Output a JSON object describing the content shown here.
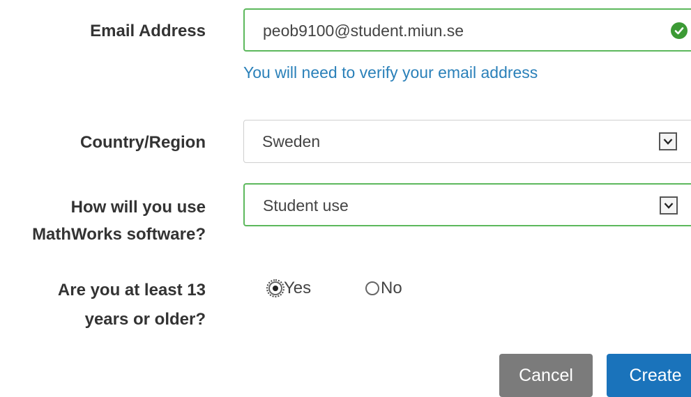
{
  "email": {
    "label": "Email Address",
    "value": "peob9100@student.miun.se",
    "status_icon": "check-circle-icon",
    "hint": "You will need to verify your email address"
  },
  "country": {
    "label": "Country/Region",
    "selected": "Sweden"
  },
  "usage": {
    "label_line1": "How will you use",
    "label_line2": "MathWorks software?",
    "selected": "Student use"
  },
  "age": {
    "label_line1": "Are you at least 13",
    "label_line2": "years or older?",
    "options": [
      "Yes",
      "No"
    ],
    "selected": "Yes"
  },
  "buttons": {
    "cancel": "Cancel",
    "create": "Create"
  },
  "colors": {
    "valid_border": "#5cb85c",
    "hint_text": "#2a80b9",
    "create_button": "#1a73bb",
    "cancel_button": "#7b7b7b"
  }
}
